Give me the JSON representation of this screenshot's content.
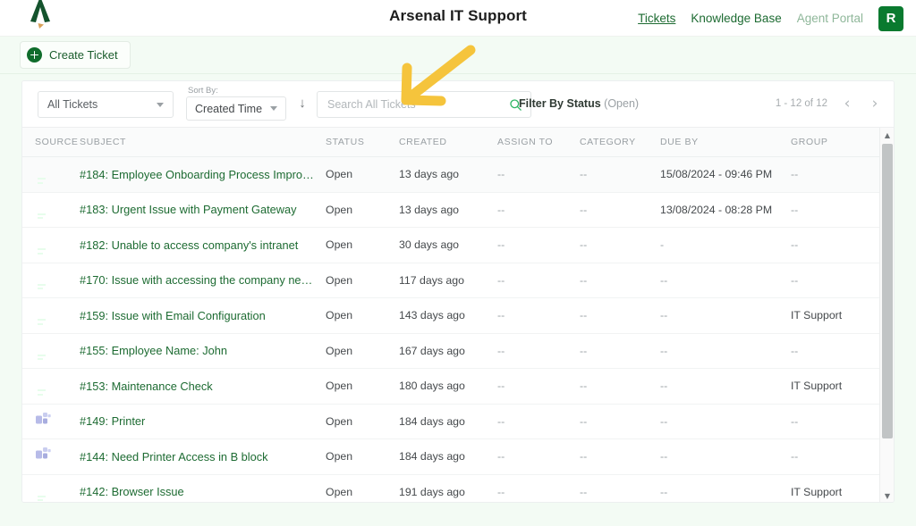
{
  "header": {
    "title": "Arsenal IT Support",
    "logo_icon": "arsenal-chevron-logo",
    "nav": [
      {
        "label": "Tickets",
        "state": "active"
      },
      {
        "label": "Knowledge Base",
        "state": "normal"
      },
      {
        "label": "Agent Portal",
        "state": "muted"
      }
    ],
    "avatar_initial": "R",
    "avatar_color": "#0a7a2f"
  },
  "actionbar": {
    "create_ticket_label": "Create Ticket",
    "create_ticket_icon": "plus-circle-icon"
  },
  "toolbar": {
    "ticket_filter_value": "All Tickets",
    "sort_by_label": "Sort By:",
    "sort_by_value": "Created Time",
    "sort_direction_icon": "arrow-down-icon",
    "search": {
      "value": "",
      "placeholder": "Search All Tickets",
      "icon": "search-icon",
      "icon_color": "#2eb563"
    },
    "filter_by_status_label": "Filter By Status",
    "filter_by_status_value": "(Open)",
    "pagination": {
      "count_text": "1 - 12 of 12",
      "prev_icon": "chevron-left-icon",
      "next_icon": "chevron-right-icon"
    }
  },
  "table": {
    "columns": [
      "SOURCE",
      "SUBJECT",
      "STATUS",
      "CREATED",
      "ASSIGN TO",
      "CATEGORY",
      "DUE BY",
      "GROUP"
    ],
    "rows": [
      {
        "source_icon": "email-icon",
        "subject": "#184: Employee Onboarding Process Impro…",
        "status": "Open",
        "created": "13 days ago",
        "assign_to": "--",
        "category": "--",
        "due_by": "15/08/2024 - 09:46 PM",
        "group": "--"
      },
      {
        "source_icon": "email-icon",
        "subject": "#183: Urgent Issue with Payment Gateway",
        "status": "Open",
        "created": "13 days ago",
        "assign_to": "--",
        "category": "--",
        "due_by": "13/08/2024 - 08:28 PM",
        "group": "--"
      },
      {
        "source_icon": "email-icon",
        "subject": "#182: Unable to access company's intranet",
        "status": "Open",
        "created": "30 days ago",
        "assign_to": "--",
        "category": "--",
        "due_by": "-",
        "group": "--"
      },
      {
        "source_icon": "email-icon",
        "subject": "#170: Issue with accessing the company ne…",
        "status": "Open",
        "created": "117 days ago",
        "assign_to": "--",
        "category": "--",
        "due_by": "--",
        "group": "--"
      },
      {
        "source_icon": "email-icon",
        "subject": "#159: Issue with Email Configuration",
        "status": "Open",
        "created": "143 days ago",
        "assign_to": "--",
        "category": "--",
        "due_by": "--",
        "group": "IT Support"
      },
      {
        "source_icon": "email-icon",
        "subject": "#155: Employee Name: John",
        "status": "Open",
        "created": "167 days ago",
        "assign_to": "--",
        "category": "--",
        "due_by": "--",
        "group": "--"
      },
      {
        "source_icon": "email-icon",
        "subject": "#153: Maintenance Check",
        "status": "Open",
        "created": "180 days ago",
        "assign_to": "--",
        "category": "--",
        "due_by": "--",
        "group": "IT Support"
      },
      {
        "source_icon": "portal-icon",
        "subject": "#149: Printer",
        "status": "Open",
        "created": "184 days ago",
        "assign_to": "--",
        "category": "--",
        "due_by": "--",
        "group": "--"
      },
      {
        "source_icon": "portal-icon",
        "subject": "#144: Need Printer Access in B block",
        "status": "Open",
        "created": "184 days ago",
        "assign_to": "--",
        "category": "--",
        "due_by": "--",
        "group": "--"
      },
      {
        "source_icon": "email-icon",
        "subject": "#142: Browser Issue",
        "status": "Open",
        "created": "191 days ago",
        "assign_to": "--",
        "category": "--",
        "due_by": "--",
        "group": "IT Support"
      }
    ]
  },
  "scrollbar": {
    "up_icon": "scroll-up-arrow-icon",
    "down_icon": "scroll-down-arrow-icon"
  },
  "annotation": {
    "arrow_icon": "pointer-arrow-icon",
    "color": "#f5c43c"
  }
}
